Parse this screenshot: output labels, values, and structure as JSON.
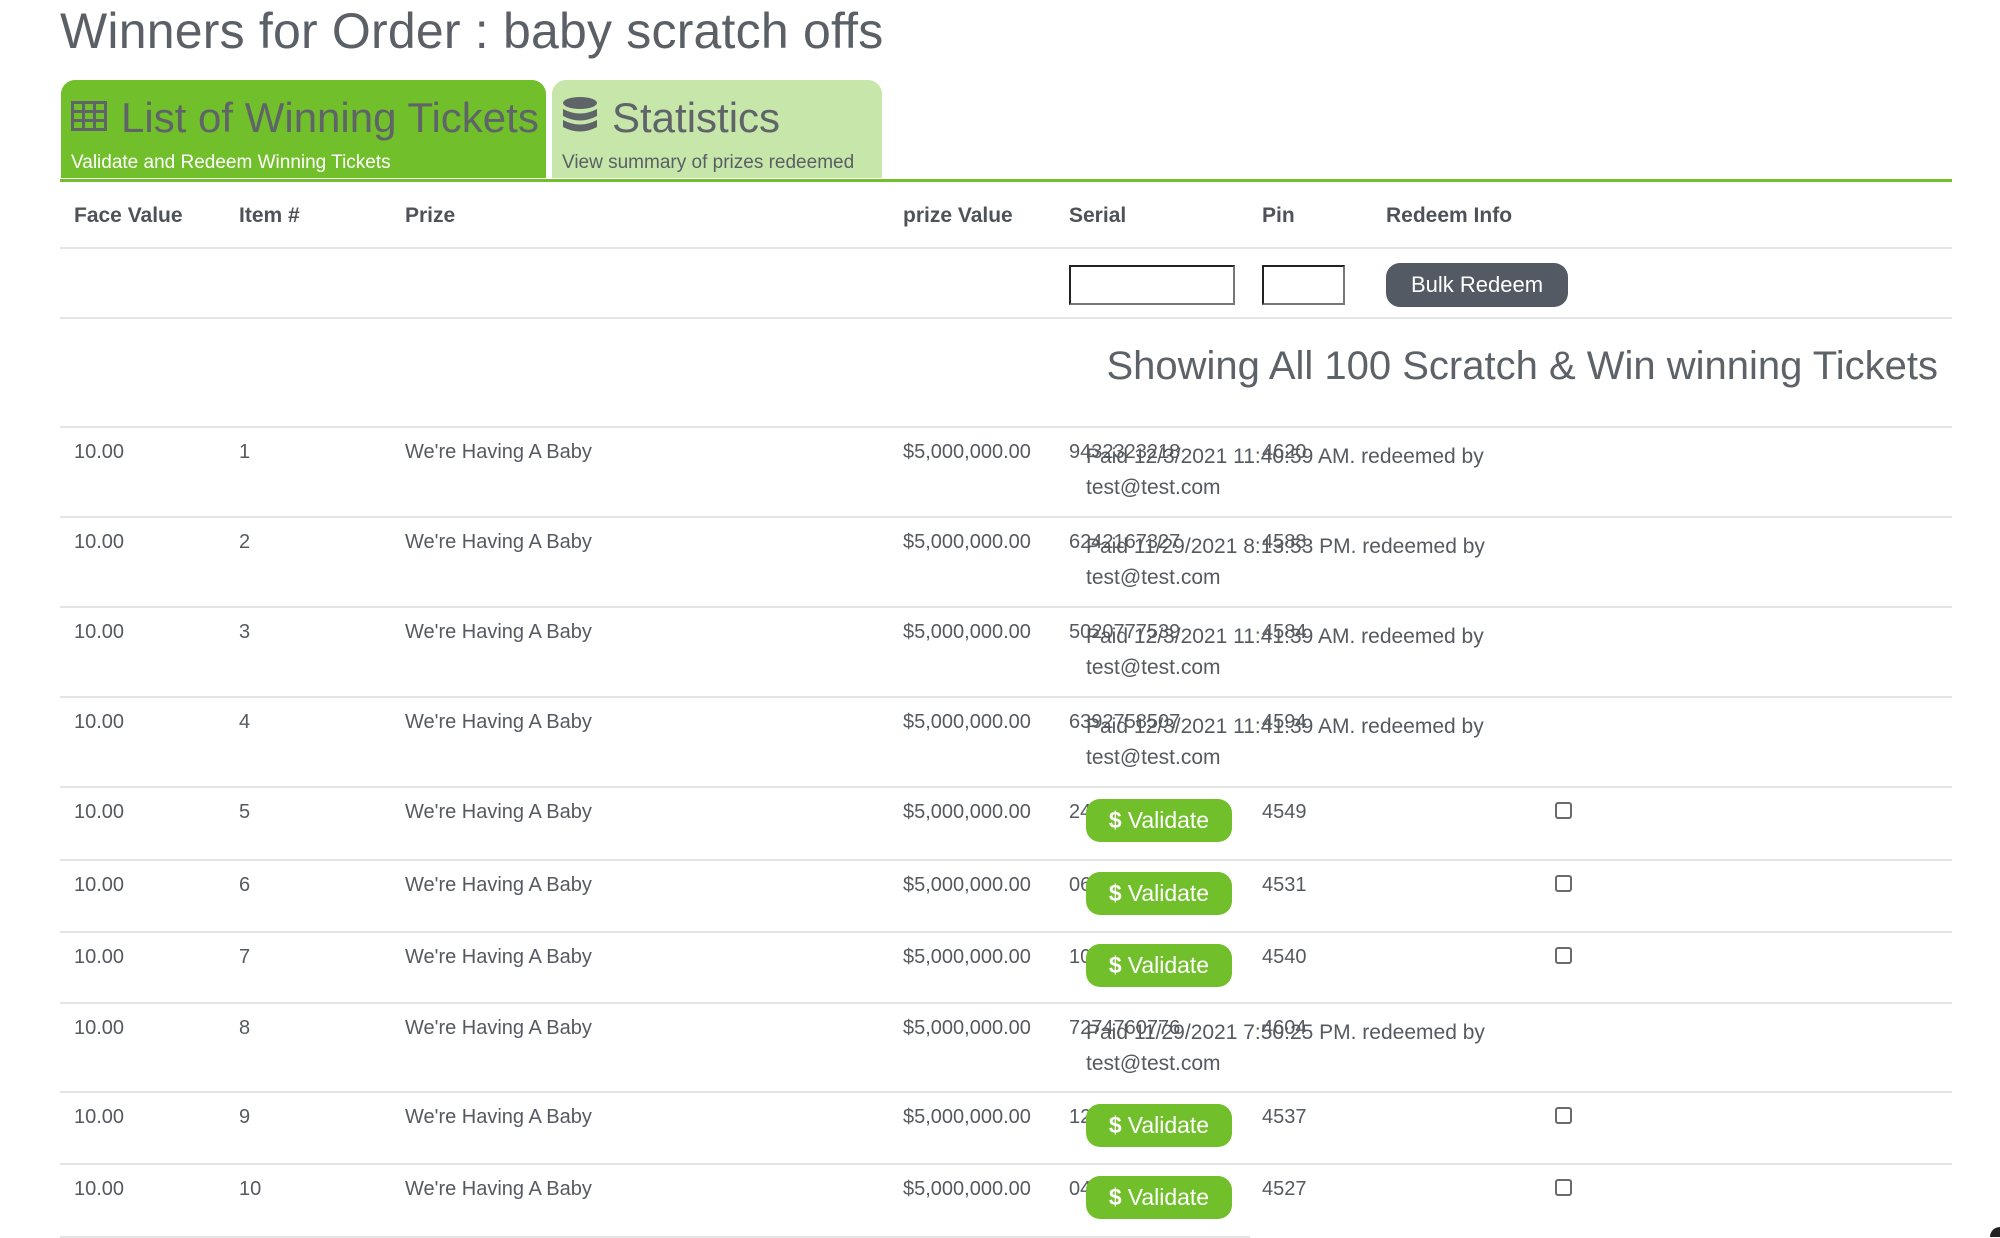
{
  "page": {
    "title": "Winners for Order : baby scratch offs"
  },
  "tabs": [
    {
      "label": "List of Winning Tickets",
      "subtitle": "Validate and Redeem Winning Tickets",
      "icon": "table-icon",
      "active": true
    },
    {
      "label": "Statistics",
      "subtitle": "View summary of prizes redeemed",
      "icon": "database-icon",
      "active": false
    }
  ],
  "colors": {
    "accent": "#72bf2c",
    "accent_light": "#c6e6aa",
    "dark_button": "#545a63"
  },
  "table": {
    "columns": [
      "Face Value",
      "Item #",
      "Prize",
      "prize Value",
      "Serial",
      "Pin",
      "Redeem Info"
    ],
    "filters": {
      "serial_value": "",
      "pin_value": "",
      "bulk_redeem_label": "Bulk Redeem"
    },
    "summary": "Showing All 100 Scratch & Win winning Tickets",
    "validate_label": "Validate",
    "rows": [
      {
        "face_value": "10.00",
        "item": "1",
        "prize": "We're Having A Baby",
        "prize_value": "$5,000,000.00",
        "serial": "9432323218",
        "pin": "4620",
        "status": "paid",
        "redeem_info": "Paid 12/3/2021 11:40:59 AM. redeemed by test@test.com"
      },
      {
        "face_value": "10.00",
        "item": "2",
        "prize": "We're Having A Baby",
        "prize_value": "$5,000,000.00",
        "serial": "6242167327",
        "pin": "4588",
        "status": "paid",
        "redeem_info": "Paid 11/29/2021 8:13:53 PM. redeemed by test@test.com"
      },
      {
        "face_value": "10.00",
        "item": "3",
        "prize": "We're Having A Baby",
        "prize_value": "$5,000,000.00",
        "serial": "5020777539",
        "pin": "4584",
        "status": "paid",
        "redeem_info": "Paid 12/3/2021 11:41:39 AM. redeemed by test@test.com"
      },
      {
        "face_value": "10.00",
        "item": "4",
        "prize": "We're Having A Baby",
        "prize_value": "$5,000,000.00",
        "serial": "6392758507",
        "pin": "4594",
        "status": "paid",
        "redeem_info": "Paid 12/3/2021 11:41:39 AM. redeemed by test@test.com"
      },
      {
        "face_value": "10.00",
        "item": "5",
        "prize": "We're Having A Baby",
        "prize_value": "$5,000,000.00",
        "serial": "2456267711",
        "pin": "4549",
        "status": "unpaid",
        "checked": false
      },
      {
        "face_value": "10.00",
        "item": "6",
        "prize": "We're Having A Baby",
        "prize_value": "$5,000,000.00",
        "serial": "0674457856",
        "pin": "4531",
        "status": "unpaid",
        "checked": false
      },
      {
        "face_value": "10.00",
        "item": "7",
        "prize": "We're Having A Baby",
        "prize_value": "$5,000,000.00",
        "serial": "1010350573",
        "pin": "4540",
        "status": "unpaid",
        "checked": false
      },
      {
        "face_value": "10.00",
        "item": "8",
        "prize": "We're Having A Baby",
        "prize_value": "$5,000,000.00",
        "serial": "7274760776",
        "pin": "4604",
        "status": "paid",
        "redeem_info": "Paid 11/29/2021 7:50:25 PM. redeemed by test@test.com"
      },
      {
        "face_value": "10.00",
        "item": "9",
        "prize": "We're Having A Baby",
        "prize_value": "$5,000,000.00",
        "serial": "1250032753",
        "pin": "4537",
        "status": "unpaid",
        "checked": false
      },
      {
        "face_value": "10.00",
        "item": "10",
        "prize": "We're Having A Baby",
        "prize_value": "$5,000,000.00",
        "serial": "0455003147",
        "pin": "4527",
        "status": "unpaid",
        "checked": false
      }
    ]
  }
}
